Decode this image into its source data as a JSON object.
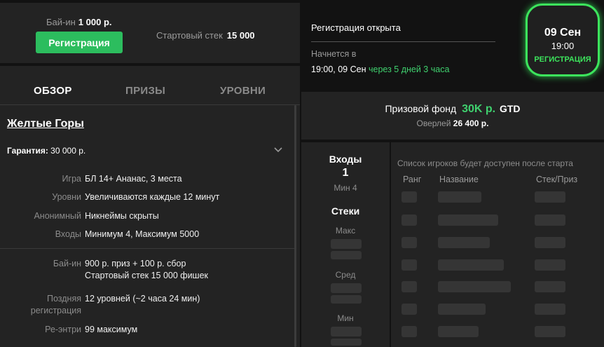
{
  "top": {
    "buyin_label": "Бай-ин",
    "buyin_value": "1 000 р.",
    "register_label": "Регистрация",
    "stack_label": "Стартовый стек",
    "stack_value": "15 000"
  },
  "tabs": [
    {
      "label": "ОБЗОР",
      "active": true
    },
    {
      "label": "ПРИЗЫ",
      "active": false
    },
    {
      "label": "УРОВНИ",
      "active": false
    }
  ],
  "overview": {
    "title": "Желтые Горы",
    "guarantee_label": "Гарантия:",
    "guarantee_value": "30 000 р.",
    "rows": [
      {
        "key": "Игра",
        "value": "БЛ 14+ Ананас, 3 места"
      },
      {
        "key": "Уровни",
        "value": "Увеличиваются каждые 12 минут"
      },
      {
        "key": "Анонимный",
        "value": "Никнеймы скрыты"
      },
      {
        "key": "Входы",
        "value": "Минимум 4, Максимум 5000"
      }
    ],
    "buyin_key": "Бай-ин",
    "buyin_value_1": "900 р. приз + 100 р. сбор",
    "buyin_value_2": "Стартовый стек 15 000 фишек",
    "late_key_1": "Поздняя",
    "late_key_2": "регистрация",
    "late_value": "12 уровней (~2 часа 24 мин)",
    "reentry_key": "Ре-энтри",
    "reentry_value": "99 максимум"
  },
  "status": {
    "registration_open": "Регистрация открыта",
    "starts_label": "Начнется в",
    "starts_when": "19:00, 09 Сен",
    "starts_in": "через 5 дней 3 часа"
  },
  "badge": {
    "date": "09 Сен",
    "time": "19:00",
    "label": "РЕГИСТРАЦИЯ"
  },
  "prize": {
    "label": "Призовой фонд",
    "amount": "30K р.",
    "gtd": "GTD",
    "overlay_label": "Оверлей",
    "overlay_value": "26 400 р."
  },
  "entries": {
    "label": "Входы",
    "count": "1",
    "min_label": "Мин 4",
    "stacks_label": "Стеки",
    "max_label": "Макс",
    "avg_label": "Сред",
    "min_stack_label": "Мин"
  },
  "players": {
    "note": "Список игроков будет доступен после старта",
    "col_rank": "Ранг",
    "col_name": "Название",
    "col_stack": "Стек/Приз",
    "placeholder_rows": 7
  },
  "colors": {
    "accent_green": "#2cbd5e",
    "badge_green": "#3ce45c",
    "panel": "#232323",
    "background": "#121212"
  }
}
